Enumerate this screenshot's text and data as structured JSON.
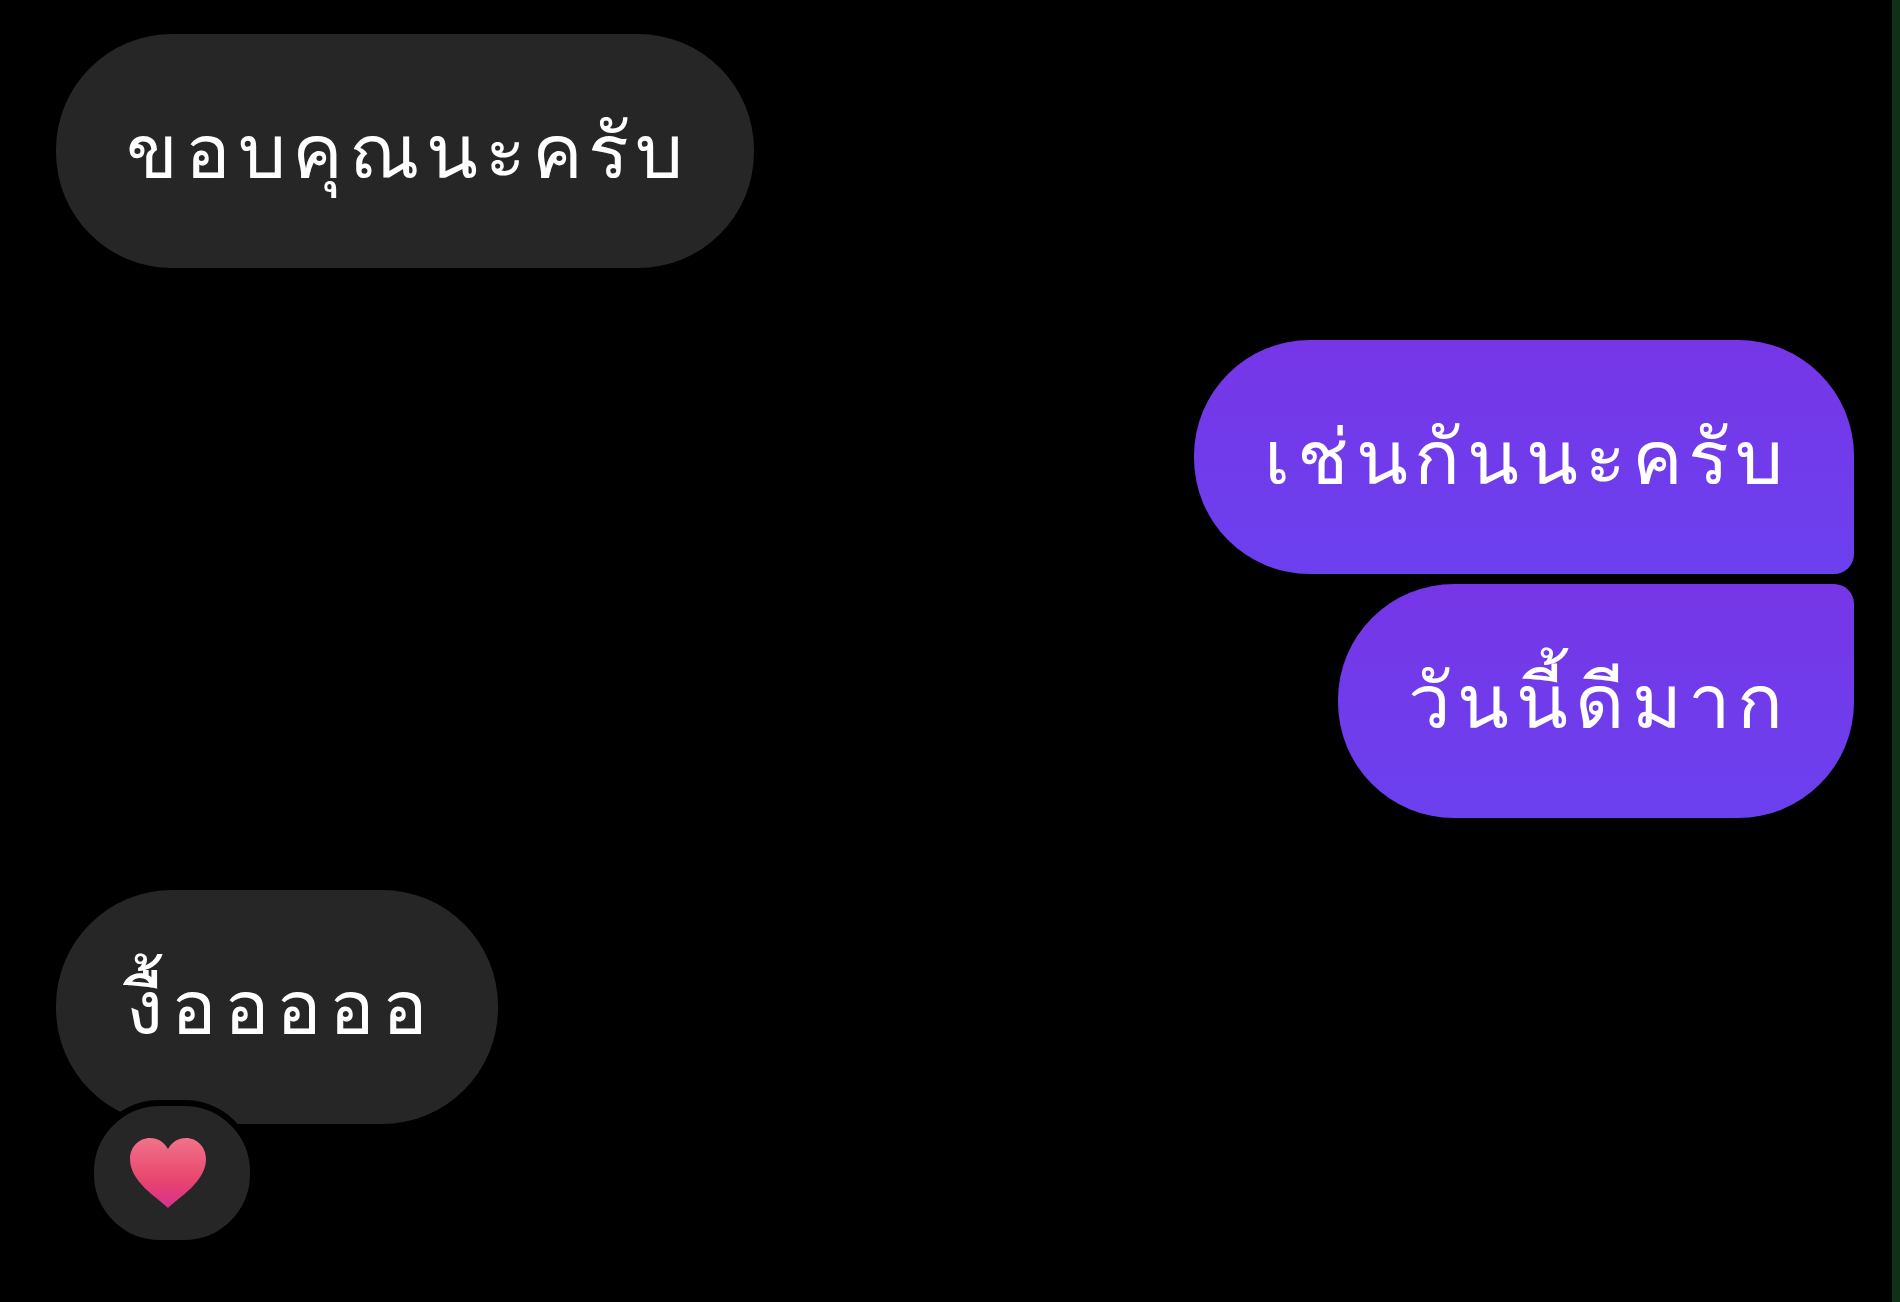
{
  "messages": [
    {
      "kind": "incoming",
      "text": "ขอบคุณนะครับ",
      "reacted": false
    },
    {
      "kind": "outgoing",
      "text": "เช่นกันนะครับ",
      "reacted": false
    },
    {
      "kind": "outgoing",
      "text": "วันนี้ดีมาก",
      "reacted": false
    },
    {
      "kind": "incoming",
      "text": "งื้อออออ",
      "reacted": true
    }
  ]
}
